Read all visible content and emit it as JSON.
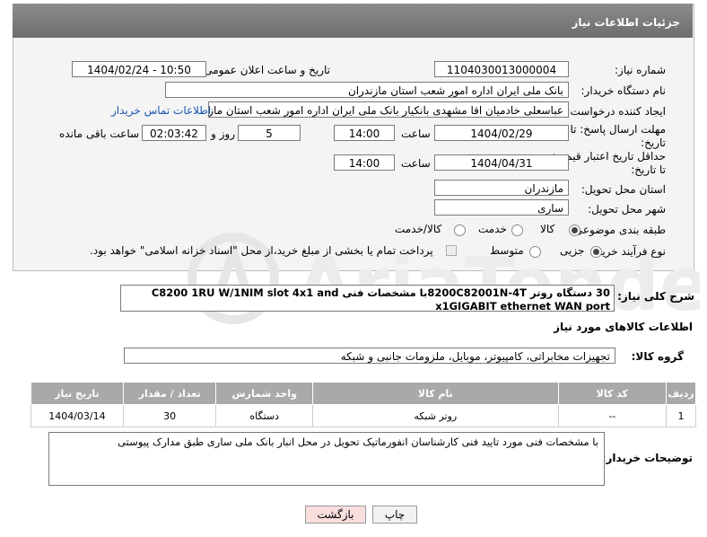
{
  "header": {
    "title": "جزئیات اطلاعات نیاز"
  },
  "fields": {
    "need_number_label": "شماره نیاز:",
    "need_number": "1104030013000004",
    "announce_label": "تاریخ و ساعت اعلان عمومی:",
    "announce_value": "1404/02/24 - 10:50",
    "buyer_org_label": "نام دستگاه خریدار:",
    "buyer_org": "بانک ملی ایران اداره امور شعب استان مازندران",
    "requester_label": "ایجاد کننده درخواست:",
    "requester": "عباسعلی خادمیان اقا مشهدی بانکیار بانک ملی ایران اداره امور شعب استان ماز",
    "contact_link": "اطلاعات تماس خریدار",
    "deadline_label_1": "مهلت ارسال پاسخ: تا",
    "deadline_label_2": "تاریخ:",
    "deadline_date": "1404/02/29",
    "hour_label": "ساعت",
    "deadline_time": "14:00",
    "days_value": "5",
    "days_label": "روز و",
    "remaining_time": "02:03:42",
    "remaining_label": "ساعت باقی مانده",
    "validity_label_1": "حداقل تاریخ اعتبار قیمت:",
    "validity_label_2": "تا تاریخ:",
    "validity_date": "1404/04/31",
    "validity_hour_label": "ساعت",
    "validity_time": "14:00",
    "province_label": "استان محل تحویل:",
    "province": "مازندران",
    "city_label": "شهر محل تحویل:",
    "city": "ساری",
    "category_label": "طبقه بندی موضوعی:",
    "category_options": [
      "کالا",
      "خدمت",
      "کالا/خدمت"
    ],
    "category_selected": "کالا",
    "process_label": "نوع فرآیند خرید :",
    "process_options": [
      "جزیی",
      "متوسط"
    ],
    "process_selected": "جزیی",
    "payment_text": "پرداخت تمام یا بخشی از مبلغ خرید،از محل \"اسناد خزانه اسلامی\" خواهد بود."
  },
  "summary": {
    "label": "شرح کلی نیاز:",
    "text": "30 دستگاه روتر 8200C82001N-4Tبا مشخصات فنی C8200 1RU W/1NIM slot 4x1 and x1GIGABIT ethernet WAN port"
  },
  "goods": {
    "section_title": "اطلاعات کالاهای مورد نیاز",
    "group_label": "گروه کالا:",
    "group_value": "تجهیزات مخابراتی، کامپیوتر، موبایل، ملزومات جانبی و شبکه",
    "columns": [
      "ردیف",
      "کد کالا",
      "نام کالا",
      "واحد شمارش",
      "تعداد / مقدار",
      "تاریخ نیاز"
    ],
    "rows": [
      {
        "index": "1",
        "code": "--",
        "name": "روتر شبکه",
        "unit": "دستگاه",
        "qty": "30",
        "date": "1404/03/14"
      }
    ]
  },
  "notes": {
    "label": "توضیحات خریدار:",
    "text": "با مشخصات فنی مورد تایید فنی کارشناسان انفورماتیک تحویل در محل انبار بانک ملی ساری طبق مدارک پیوستی"
  },
  "buttons": {
    "print": "چاپ",
    "back": "بازگشت"
  },
  "colors": {
    "header_bg": "#7b7b7b",
    "link": "#1a56b0",
    "table_header": "#a9a9a9",
    "back_btn": "#f9dede"
  }
}
